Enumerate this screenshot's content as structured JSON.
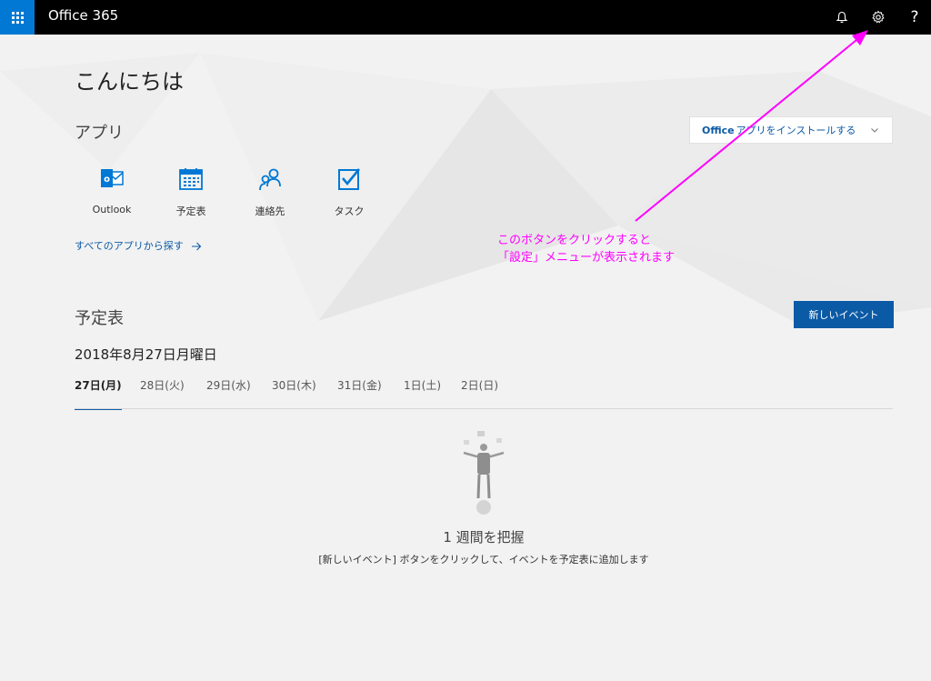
{
  "topbar": {
    "brand": "Office 365",
    "icons": {
      "apps": "waffle-icon",
      "notifications": "bell-icon",
      "settings": "gear-icon",
      "help": "question-icon"
    },
    "help_glyph": "?"
  },
  "colors": {
    "accent": "#0078d4",
    "link": "#0b5aa5",
    "annotation": "#ff00ff"
  },
  "greeting": "こんにちは",
  "apps_section": {
    "title": "アプリ",
    "install": {
      "brand": "Office",
      "label": " アプリをインストールする"
    },
    "items": [
      {
        "label": "Outlook",
        "icon": "outlook-icon"
      },
      {
        "label": "予定表",
        "icon": "calendar-icon"
      },
      {
        "label": "連絡先",
        "icon": "people-icon"
      },
      {
        "label": "タスク",
        "icon": "tasks-icon"
      }
    ],
    "all_apps_link": "すべてのアプリから探す"
  },
  "calendar": {
    "title": "予定表",
    "new_event": "新しいイベント",
    "date_heading": "2018年8月27日月曜日",
    "tabs": [
      "27日(月)",
      "28日(火)",
      "29日(水)",
      "30日(木)",
      "31日(金)",
      "1日(土)",
      "2日(日)"
    ],
    "active_tab": "27日(月)",
    "empty_title": "1 週間を把握",
    "empty_desc": "[新しいイベント] ボタンをクリックして、イベントを予定表に追加します"
  },
  "annotation": {
    "line1": "このボタンをクリックすると",
    "line2": "「設定」メニューが表示されます"
  }
}
